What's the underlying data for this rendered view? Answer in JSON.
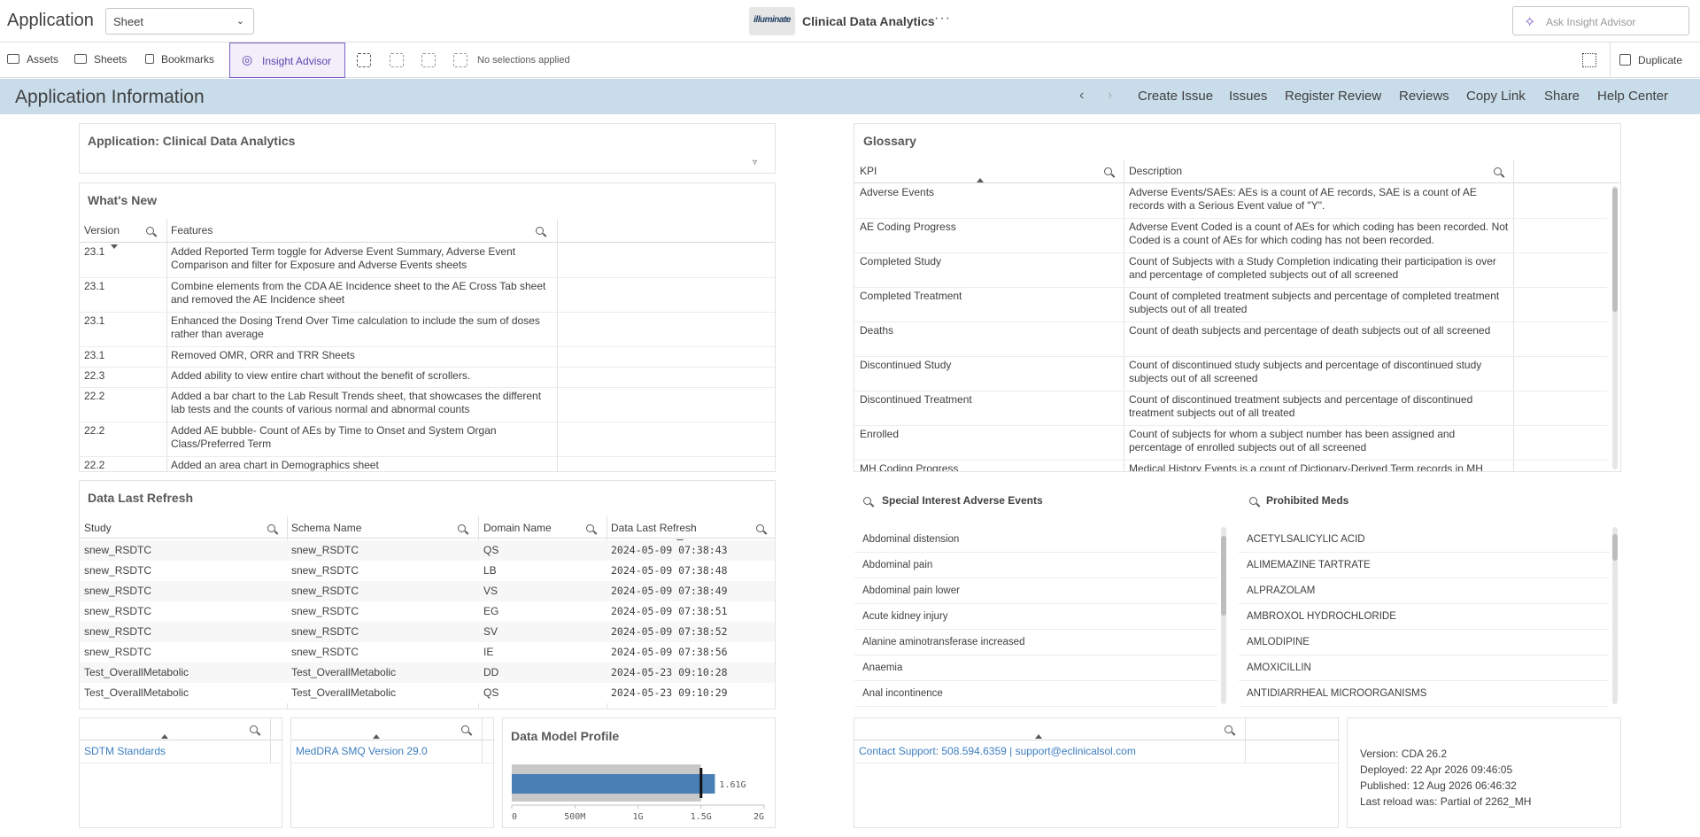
{
  "topbar": {
    "app_label": "Application",
    "sheet_select": "Sheet",
    "logo_text": "illuminate",
    "app_title": "Clinical Data Analytics",
    "more": "···",
    "ask_placeholder": "Ask Insight Advisor"
  },
  "toolbar": {
    "assets": "Assets",
    "sheets": "Sheets",
    "bookmarks": "Bookmarks",
    "insight_advisor": "Insight Advisor",
    "no_selections": "No selections applied",
    "duplicate": "Duplicate"
  },
  "band": {
    "title": "Application Information",
    "links": [
      "Create Issue",
      "Issues",
      "Register Review",
      "Reviews",
      "Copy Link",
      "Share",
      "Help Center"
    ]
  },
  "app_panel": {
    "title": "Application: Clinical Data Analytics"
  },
  "whats_new": {
    "title": "What's New",
    "col_version": "Version",
    "col_features": "Features",
    "rows": [
      {
        "version": "23.1",
        "feature": "Added Reported Term toggle for Adverse Event Summary, Adverse Event Comparison and filter for Exposure and Adverse Events sheets"
      },
      {
        "version": "23.1",
        "feature": "Combine elements from the CDA AE Incidence sheet to the AE Cross Tab sheet and removed the AE Incidence sheet"
      },
      {
        "version": "23.1",
        "feature": "Enhanced the Dosing Trend Over Time calculation to include the sum of doses rather than average"
      },
      {
        "version": "23.1",
        "feature": "Removed OMR, ORR and TRR Sheets"
      },
      {
        "version": "22.3",
        "feature": "Added ability to view entire chart without the benefit of scrollers."
      },
      {
        "version": "22.2",
        "feature": "Added a bar chart to the Lab Result Trends sheet, that showcases the different lab tests and the counts of various normal and abnormal counts"
      },
      {
        "version": "22.2",
        "feature": "Added AE bubble- Count of AEs by Time to Onset and System Organ Class/Preferred Term"
      },
      {
        "version": "22.2",
        "feature": "Added an area chart in Demographics sheet"
      }
    ]
  },
  "glossary": {
    "title": "Glossary",
    "col_kpi": "KPI",
    "col_desc": "Description",
    "rows": [
      {
        "kpi": "Adverse Events",
        "desc": "Adverse Events/SAEs: AEs is a count of AE records, SAE is a count of AE records with a Serious Event value of \"Y\"."
      },
      {
        "kpi": "AE Coding Progress",
        "desc": "Adverse Event Coded is a count of AEs for which coding has been recorded. Not Coded is a count of AEs for which coding has not been recorded."
      },
      {
        "kpi": "Completed Study",
        "desc": "Count of Subjects with a Study Completion indicating their participation is over and percentage of completed subjects out of all screened"
      },
      {
        "kpi": "Completed Treatment",
        "desc": "Count of completed treatment subjects and percentage of completed treatment subjects out of all treated"
      },
      {
        "kpi": "Deaths",
        "desc": "Count of death subjects and percentage of death subjects out of all screened"
      },
      {
        "kpi": "Discontinued Study",
        "desc": "Count of discontinued study subjects and percentage of discontinued study subjects out of all screened"
      },
      {
        "kpi": "Discontinued Treatment",
        "desc": "Count of discontinued treatment subjects and percentage of discontinued treatment subjects out of all treated"
      },
      {
        "kpi": "Enrolled",
        "desc": "Count of subjects for whom a subject number has been assigned and percentage of enrolled subjects out of all screened"
      },
      {
        "kpi": "MH Coding Progress",
        "desc": "Medical History Events is a count of Dictionary-Derived Term records in MH"
      }
    ]
  },
  "refresh": {
    "title": "Data Last Refresh",
    "cols": [
      "Study",
      "Schema Name",
      "Domain Name",
      "Data Last Refresh"
    ],
    "rows": [
      [
        "snew_RSDTC",
        "snew_RSDTC",
        "QS",
        "2024-05-09 07:38:43"
      ],
      [
        "snew_RSDTC",
        "snew_RSDTC",
        "LB",
        "2024-05-09 07:38:48"
      ],
      [
        "snew_RSDTC",
        "snew_RSDTC",
        "VS",
        "2024-05-09 07:38:49"
      ],
      [
        "snew_RSDTC",
        "snew_RSDTC",
        "EG",
        "2024-05-09 07:38:51"
      ],
      [
        "snew_RSDTC",
        "snew_RSDTC",
        "SV",
        "2024-05-09 07:38:52"
      ],
      [
        "snew_RSDTC",
        "snew_RSDTC",
        "IE",
        "2024-05-09 07:38:56"
      ],
      [
        "Test_OverallMetabolic",
        "Test_OverallMetabolic",
        "DD",
        "2024-05-23 09:10:28"
      ],
      [
        "Test_OverallMetabolic",
        "Test_OverallMetabolic",
        "QS",
        "2024-05-23 09:10:29"
      ]
    ]
  },
  "special_ae": {
    "title": "Special Interest Adverse Events",
    "items": [
      "Abdominal distension",
      "Abdominal pain",
      "Abdominal pain lower",
      "Acute kidney injury",
      "Alanine aminotransferase increased",
      "Anaemia",
      "Anal incontinence"
    ]
  },
  "prohibited": {
    "title": "Prohibited Meds",
    "items": [
      "ACETYLSALICYLIC ACID",
      "ALIMEMAZINE TARTRATE",
      "ALPRAZOLAM",
      "AMBROXOL HYDROCHLORIDE",
      "AMLODIPINE",
      "AMOXICILLIN",
      "ANTIDIARRHEAL MICROORGANISMS"
    ]
  },
  "links": {
    "sdtm": "SDTM Standards",
    "meddra": "MedDRA SMQ Version 29.0",
    "contact": "Contact Support: 508.594.6359 | support@eclinicalsol.com"
  },
  "data_model": {
    "title": "Data Model Profile",
    "value_label": "1.61G",
    "axis_ticks": [
      "0",
      "500M",
      "1G",
      "1.5G",
      "2G"
    ]
  },
  "chart_data": {
    "type": "bar",
    "title": "Data Model Profile",
    "categories": [
      ""
    ],
    "values": [
      1.61
    ],
    "unit": "G",
    "xlim": [
      0,
      2
    ],
    "range_band": [
      0,
      1.5
    ],
    "target_marker": 1.5,
    "tick_labels": [
      "0",
      "500M",
      "1G",
      "1.5G",
      "2G"
    ],
    "bar_color": "#4a7fb5",
    "band_color": "#c8c8c8"
  },
  "version_info": {
    "lines": [
      "Version: CDA 26.2",
      "Deployed: 22 Apr 2026 09:46:05",
      "Published: 12 Aug 2026 06:46:32",
      "Last reload was: Partial of 2262_MH"
    ]
  },
  "colors": {
    "band": "#c8dcea",
    "accent": "#7b61c5",
    "link": "#3d7ec0"
  }
}
